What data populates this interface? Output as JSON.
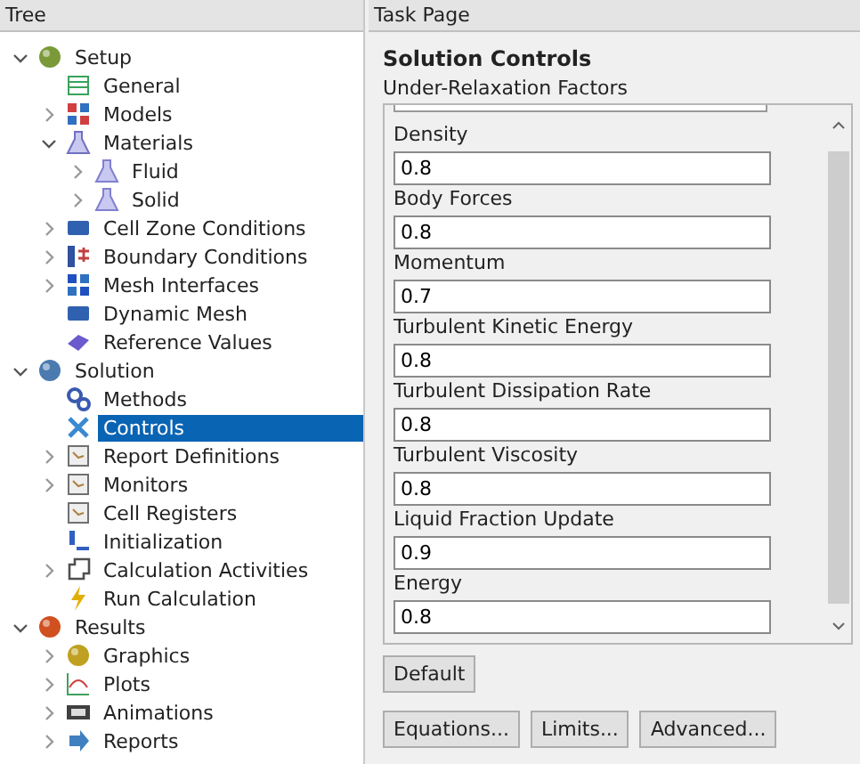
{
  "tree": {
    "title": "Tree",
    "items": [
      {
        "label": "Setup",
        "expanded": true,
        "selected": false,
        "children": [
          {
            "label": "General",
            "selected": false
          },
          {
            "label": "Models",
            "expanded": false,
            "selected": false
          },
          {
            "label": "Materials",
            "expanded": true,
            "selected": false,
            "children": [
              {
                "label": "Fluid",
                "expanded": false,
                "selected": false
              },
              {
                "label": "Solid",
                "expanded": false,
                "selected": false
              }
            ]
          },
          {
            "label": "Cell Zone Conditions",
            "expanded": false,
            "selected": false
          },
          {
            "label": "Boundary Conditions",
            "expanded": false,
            "selected": false
          },
          {
            "label": "Mesh Interfaces",
            "expanded": false,
            "selected": false
          },
          {
            "label": "Dynamic Mesh",
            "selected": false
          },
          {
            "label": "Reference Values",
            "selected": false
          }
        ]
      },
      {
        "label": "Solution",
        "expanded": true,
        "selected": false,
        "children": [
          {
            "label": "Methods",
            "selected": false
          },
          {
            "label": "Controls",
            "selected": true
          },
          {
            "label": "Report Definitions",
            "expanded": false,
            "selected": false
          },
          {
            "label": "Monitors",
            "expanded": false,
            "selected": false
          },
          {
            "label": "Cell Registers",
            "selected": false
          },
          {
            "label": "Initialization",
            "selected": false
          },
          {
            "label": "Calculation Activities",
            "expanded": false,
            "selected": false
          },
          {
            "label": "Run Calculation",
            "selected": false
          }
        ]
      },
      {
        "label": "Results",
        "expanded": true,
        "selected": false,
        "children": [
          {
            "label": "Graphics",
            "expanded": false,
            "selected": false
          },
          {
            "label": "Plots",
            "expanded": false,
            "selected": false
          },
          {
            "label": "Animations",
            "expanded": false,
            "selected": false
          },
          {
            "label": "Reports",
            "expanded": false,
            "selected": false
          }
        ]
      }
    ]
  },
  "task_page": {
    "title": "Task Page",
    "heading": "Solution Controls",
    "group_label": "Under-Relaxation Factors",
    "fields": [
      {
        "label": "Density",
        "value": "0.8"
      },
      {
        "label": "Body Forces",
        "value": "0.8"
      },
      {
        "label": "Momentum",
        "value": "0.7"
      },
      {
        "label": "Turbulent Kinetic Energy",
        "value": "0.8"
      },
      {
        "label": "Turbulent Dissipation Rate",
        "value": "0.8"
      },
      {
        "label": "Turbulent Viscosity",
        "value": "0.8"
      },
      {
        "label": "Liquid Fraction Update",
        "value": "0.9"
      },
      {
        "label": "Energy",
        "value": "0.8"
      }
    ],
    "default_button": "Default",
    "buttons": [
      "Equations...",
      "Limits...",
      "Advanced..."
    ]
  }
}
